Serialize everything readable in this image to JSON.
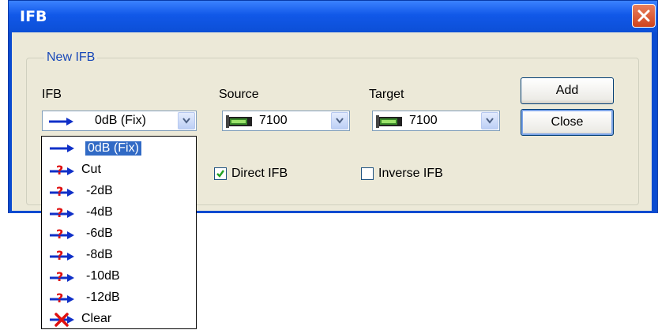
{
  "window": {
    "title": "IFB"
  },
  "group": {
    "legend": "New IFB"
  },
  "ifb": {
    "label": "IFB",
    "value": "0dB (Fix)"
  },
  "source": {
    "label": "Source",
    "value": "7100"
  },
  "target": {
    "label": "Target",
    "value": "7100"
  },
  "buttons": {
    "add": "Add",
    "close": "Close"
  },
  "checkboxes": {
    "direct": {
      "label": "Direct IFB",
      "checked": true
    },
    "inverse": {
      "label": "Inverse IFB",
      "checked": false
    }
  },
  "dropdown": {
    "items": [
      {
        "label": "0dB (Fix)",
        "icon": "blue-arrow-icon",
        "selected": true
      },
      {
        "label": "Cut",
        "icon": "question-arrow-icon"
      },
      {
        "label": "-2dB",
        "icon": "question-arrow-icon"
      },
      {
        "label": "-4dB",
        "icon": "question-arrow-icon"
      },
      {
        "label": "-6dB",
        "icon": "question-arrow-icon"
      },
      {
        "label": "-8dB",
        "icon": "question-arrow-icon"
      },
      {
        "label": "-10dB",
        "icon": "question-arrow-icon"
      },
      {
        "label": "-12dB",
        "icon": "question-arrow-icon"
      },
      {
        "label": "Clear",
        "icon": "clear-x-icon"
      }
    ]
  },
  "colors": {
    "title_bar": "#0c4fd6",
    "selection": "#316ac5",
    "legend": "#1848b8"
  }
}
